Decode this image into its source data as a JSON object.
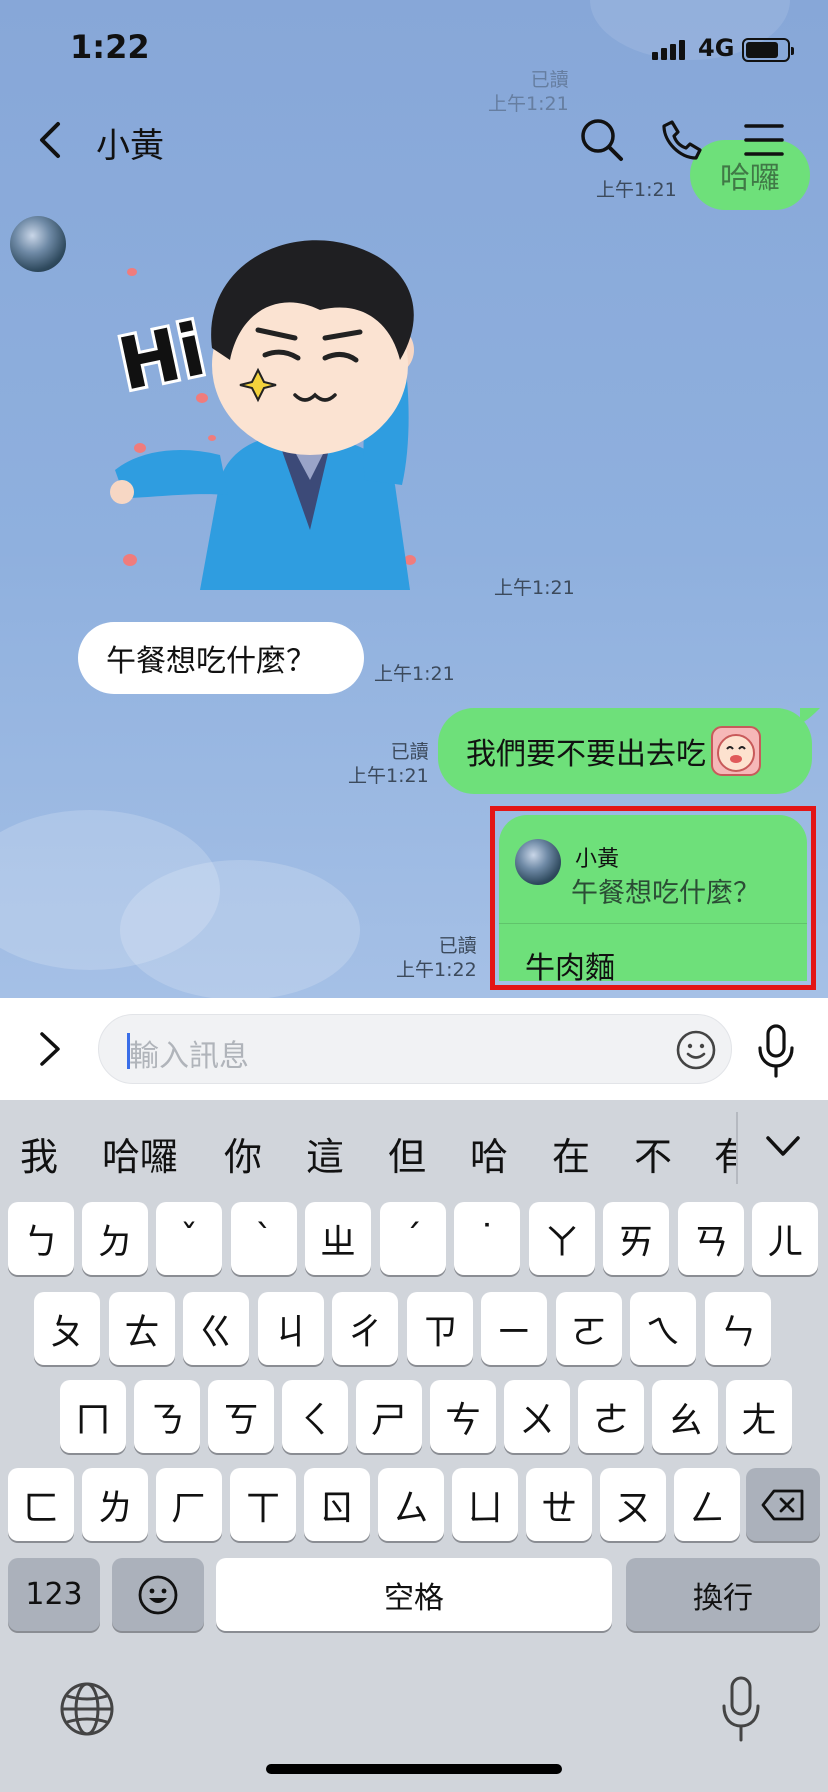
{
  "status": {
    "time": "1:22",
    "network": "4G"
  },
  "header": {
    "contact": "小黃"
  },
  "messages": {
    "top_partial": {
      "read": "已讀",
      "time": "上午1:21",
      "text": "哈囉"
    },
    "top_time": "上午1:21",
    "sticker_time": "上午1:21",
    "sticker_text": "Hi",
    "incoming": {
      "text": "午餐想吃什麼？",
      "time": "上午1:21"
    },
    "outgoing": {
      "text": "我們要不要出去吃",
      "read": "已讀",
      "time": "上午1:21"
    },
    "reply": {
      "quoted_name": "小黃",
      "quoted_text": "午餐想吃什麼？",
      "text": "牛肉麵",
      "read": "已讀",
      "time": "上午1:22"
    }
  },
  "input": {
    "placeholder": "輸入訊息"
  },
  "keyboard": {
    "candidates": [
      "我",
      "哈囉",
      "你",
      "這",
      "但",
      "哈",
      "在",
      "不",
      "有"
    ],
    "row1": [
      "ㄅ",
      "ㄉ",
      "ˇ",
      "ˋ",
      "ㄓ",
      "ˊ",
      "˙",
      "ㄚ",
      "ㄞ",
      "ㄢ",
      "ㄦ"
    ],
    "row2": [
      "ㄆ",
      "ㄊ",
      "ㄍ",
      "ㄐ",
      "ㄔ",
      "ㄗ",
      "ㄧ",
      "ㄛ",
      "ㄟ",
      "ㄣ"
    ],
    "row3": [
      "ㄇ",
      "ㄋ",
      "ㄎ",
      "ㄑ",
      "ㄕ",
      "ㄘ",
      "ㄨ",
      "ㄜ",
      "ㄠ",
      "ㄤ"
    ],
    "row4": [
      "ㄈ",
      "ㄌ",
      "ㄏ",
      "ㄒ",
      "ㄖ",
      "ㄙ",
      "ㄩ",
      "ㄝ",
      "ㄡ",
      "ㄥ"
    ],
    "numbers_label": "123",
    "space_label": "空格",
    "return_label": "換行"
  }
}
